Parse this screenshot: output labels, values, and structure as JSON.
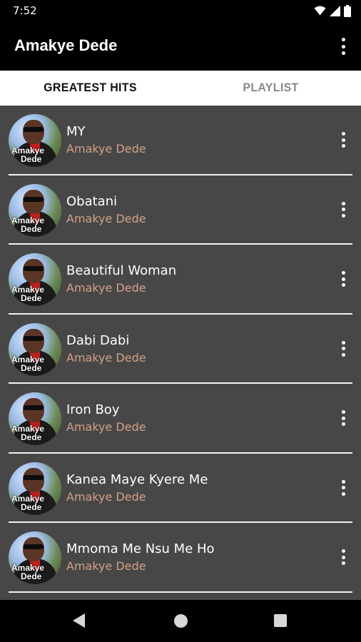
{
  "status_bar": {
    "time": "7:52",
    "icons": [
      "wifi-icon",
      "signal-icon",
      "battery-icon"
    ]
  },
  "app_bar": {
    "title": "Amakye Dede",
    "menu_icon": "overflow-menu-icon"
  },
  "tabs": [
    {
      "label": "GREATEST HITS",
      "active": true
    },
    {
      "label": "PLAYLIST",
      "active": false
    }
  ],
  "songs": [
    {
      "title": "MY",
      "artist": "Amakye Dede"
    },
    {
      "title": "Obatani",
      "artist": "Amakye Dede"
    },
    {
      "title": "Beautiful Woman",
      "artist": "Amakye Dede"
    },
    {
      "title": "Dabi Dabi",
      "artist": "Amakye Dede"
    },
    {
      "title": "Iron Boy",
      "artist": "Amakye Dede"
    },
    {
      "title": "Kanea Maye Kyere Me",
      "artist": "Amakye Dede"
    },
    {
      "title": "Mmoma Me Nsu Me Ho",
      "artist": "Amakye Dede"
    }
  ],
  "artwork_caption": {
    "line1": "Amakye",
    "line2": "Dede"
  },
  "nav_bar": {
    "icons": [
      "back-icon",
      "home-icon",
      "recents-icon"
    ]
  },
  "colors": {
    "app_bar": "#000000",
    "list_background": "#474747",
    "artist_text": "#d3a086",
    "tab_active": "#111111",
    "tab_inactive": "#8a8a8a"
  }
}
